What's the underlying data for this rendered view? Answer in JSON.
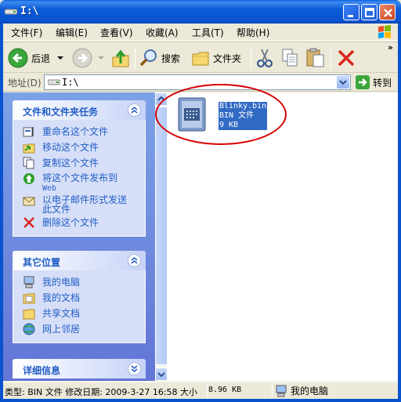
{
  "window": {
    "title": "I:\\"
  },
  "menu": {
    "items": [
      "文件(F)",
      "编辑(E)",
      "查看(V)",
      "收藏(A)",
      "工具(T)",
      "帮助(H)"
    ]
  },
  "toolbar": {
    "back": "后退",
    "search": "搜索",
    "folders": "文件夹"
  },
  "address": {
    "label": "地址(D)",
    "value": "I:\\",
    "go": "转到"
  },
  "tasks": {
    "title": "文件和文件夹任务",
    "items": [
      "重命名这个文件",
      "移动这个文件",
      "复制这个文件",
      "将这个文件发布到",
      "Web",
      "以电子邮件形式发送",
      "此文件",
      "删除这个文件"
    ]
  },
  "other_places": {
    "title": "其它位置",
    "items": [
      "我的电脑",
      "我的文档",
      "共享文档",
      "网上邻居"
    ]
  },
  "details": {
    "title": "详细信息"
  },
  "file": {
    "name": "Blinky.bin",
    "type": "BIN 文件",
    "size": "9 KB"
  },
  "status": {
    "info": "类型: BIN 文件 修改日期: 2009-3-27 16:58 大小",
    "size": "8.96 KB",
    "location": "我的电脑"
  },
  "colors": {
    "title_bar": "#0A53CF",
    "link": "#215DC6",
    "selection": "#316AC5",
    "annotation": "#D60000"
  }
}
